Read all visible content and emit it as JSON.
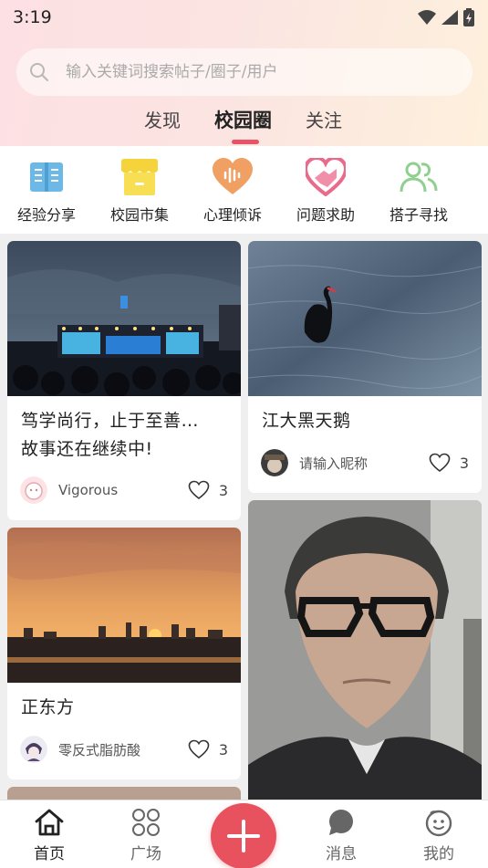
{
  "status_bar": {
    "time": "3:19"
  },
  "search": {
    "placeholder": "输入关键词搜索帖子/圈子/用户"
  },
  "top_tabs": [
    {
      "label": "发现"
    },
    {
      "label": "校园圈",
      "active": true
    },
    {
      "label": "关注"
    }
  ],
  "categories": [
    {
      "label": "经验分享",
      "icon": "book-icon",
      "color": "#6cb8e6"
    },
    {
      "label": "校园市集",
      "icon": "shop-icon",
      "color": "#f5d33a"
    },
    {
      "label": "心理倾诉",
      "icon": "heart-voice-icon",
      "color": "#f0a062"
    },
    {
      "label": "问题求助",
      "icon": "heart-handshake-icon",
      "color": "#ea6a8c"
    },
    {
      "label": "搭子寻找",
      "icon": "people-icon",
      "color": "#8fcf8f"
    }
  ],
  "posts": [
    {
      "title": "笃学尚行，止于至善…",
      "title_line2": "故事还在继续中!",
      "author": "Vigorous",
      "likes": "3",
      "image": "concert-stage-photo"
    },
    {
      "title": "江大黑天鹅",
      "author": "请输入昵称",
      "likes": "3",
      "image": "black-swan-photo"
    },
    {
      "title": "正东方",
      "author": "零反式脂肪酸",
      "likes": "3",
      "image": "sunset-skyline-photo"
    },
    {
      "title": "",
      "author": "",
      "likes": "",
      "image": "man-with-glasses-photo"
    }
  ],
  "bottom_nav": [
    {
      "label": "首页",
      "icon": "home-icon",
      "active": true
    },
    {
      "label": "广场",
      "icon": "grid-circles-icon"
    },
    {
      "label": "",
      "icon": "plus-icon"
    },
    {
      "label": "消息",
      "icon": "chat-bubble-icon"
    },
    {
      "label": "我的",
      "icon": "smile-face-icon"
    }
  ],
  "colors": {
    "accent": "#e95365",
    "fab": "#e8525f",
    "gradient_start": "#fde0e3",
    "gradient_end": "#fdf0dc"
  }
}
